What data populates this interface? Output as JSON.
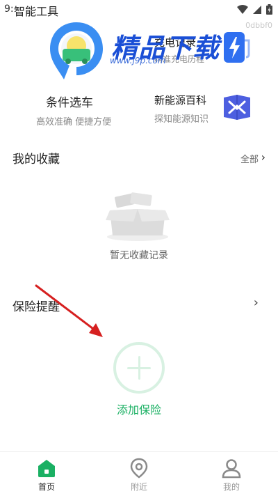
{
  "status_bar": {
    "time": "9:"
  },
  "header": {
    "title": "智能工具"
  },
  "watermark": {
    "brand": "精品下载",
    "url": "www.j9p.com"
  },
  "charge": {
    "title": "充电记录",
    "subtitle": "精准充电历程"
  },
  "faint_code": "0dbbf0",
  "tools": [
    {
      "title": "条件选车",
      "subtitle": "高效准确 便捷方便"
    },
    {
      "title": "新能源百科",
      "subtitle": "探知能源知识"
    }
  ],
  "favorites": {
    "title": "我的收藏",
    "all_label": "全部",
    "empty_text": "暂无收藏记录"
  },
  "insurance": {
    "title": "保险提醒",
    "add_label": "添加保险"
  },
  "tabbar": {
    "items": [
      {
        "label": "首页"
      },
      {
        "label": "附近"
      },
      {
        "label": "我的"
      }
    ]
  },
  "colors": {
    "accent_green": "#1ab063",
    "faint_green": "#d8f1e2",
    "brand_blue": "#1a4fd6",
    "arrow_red": "#d62020"
  }
}
